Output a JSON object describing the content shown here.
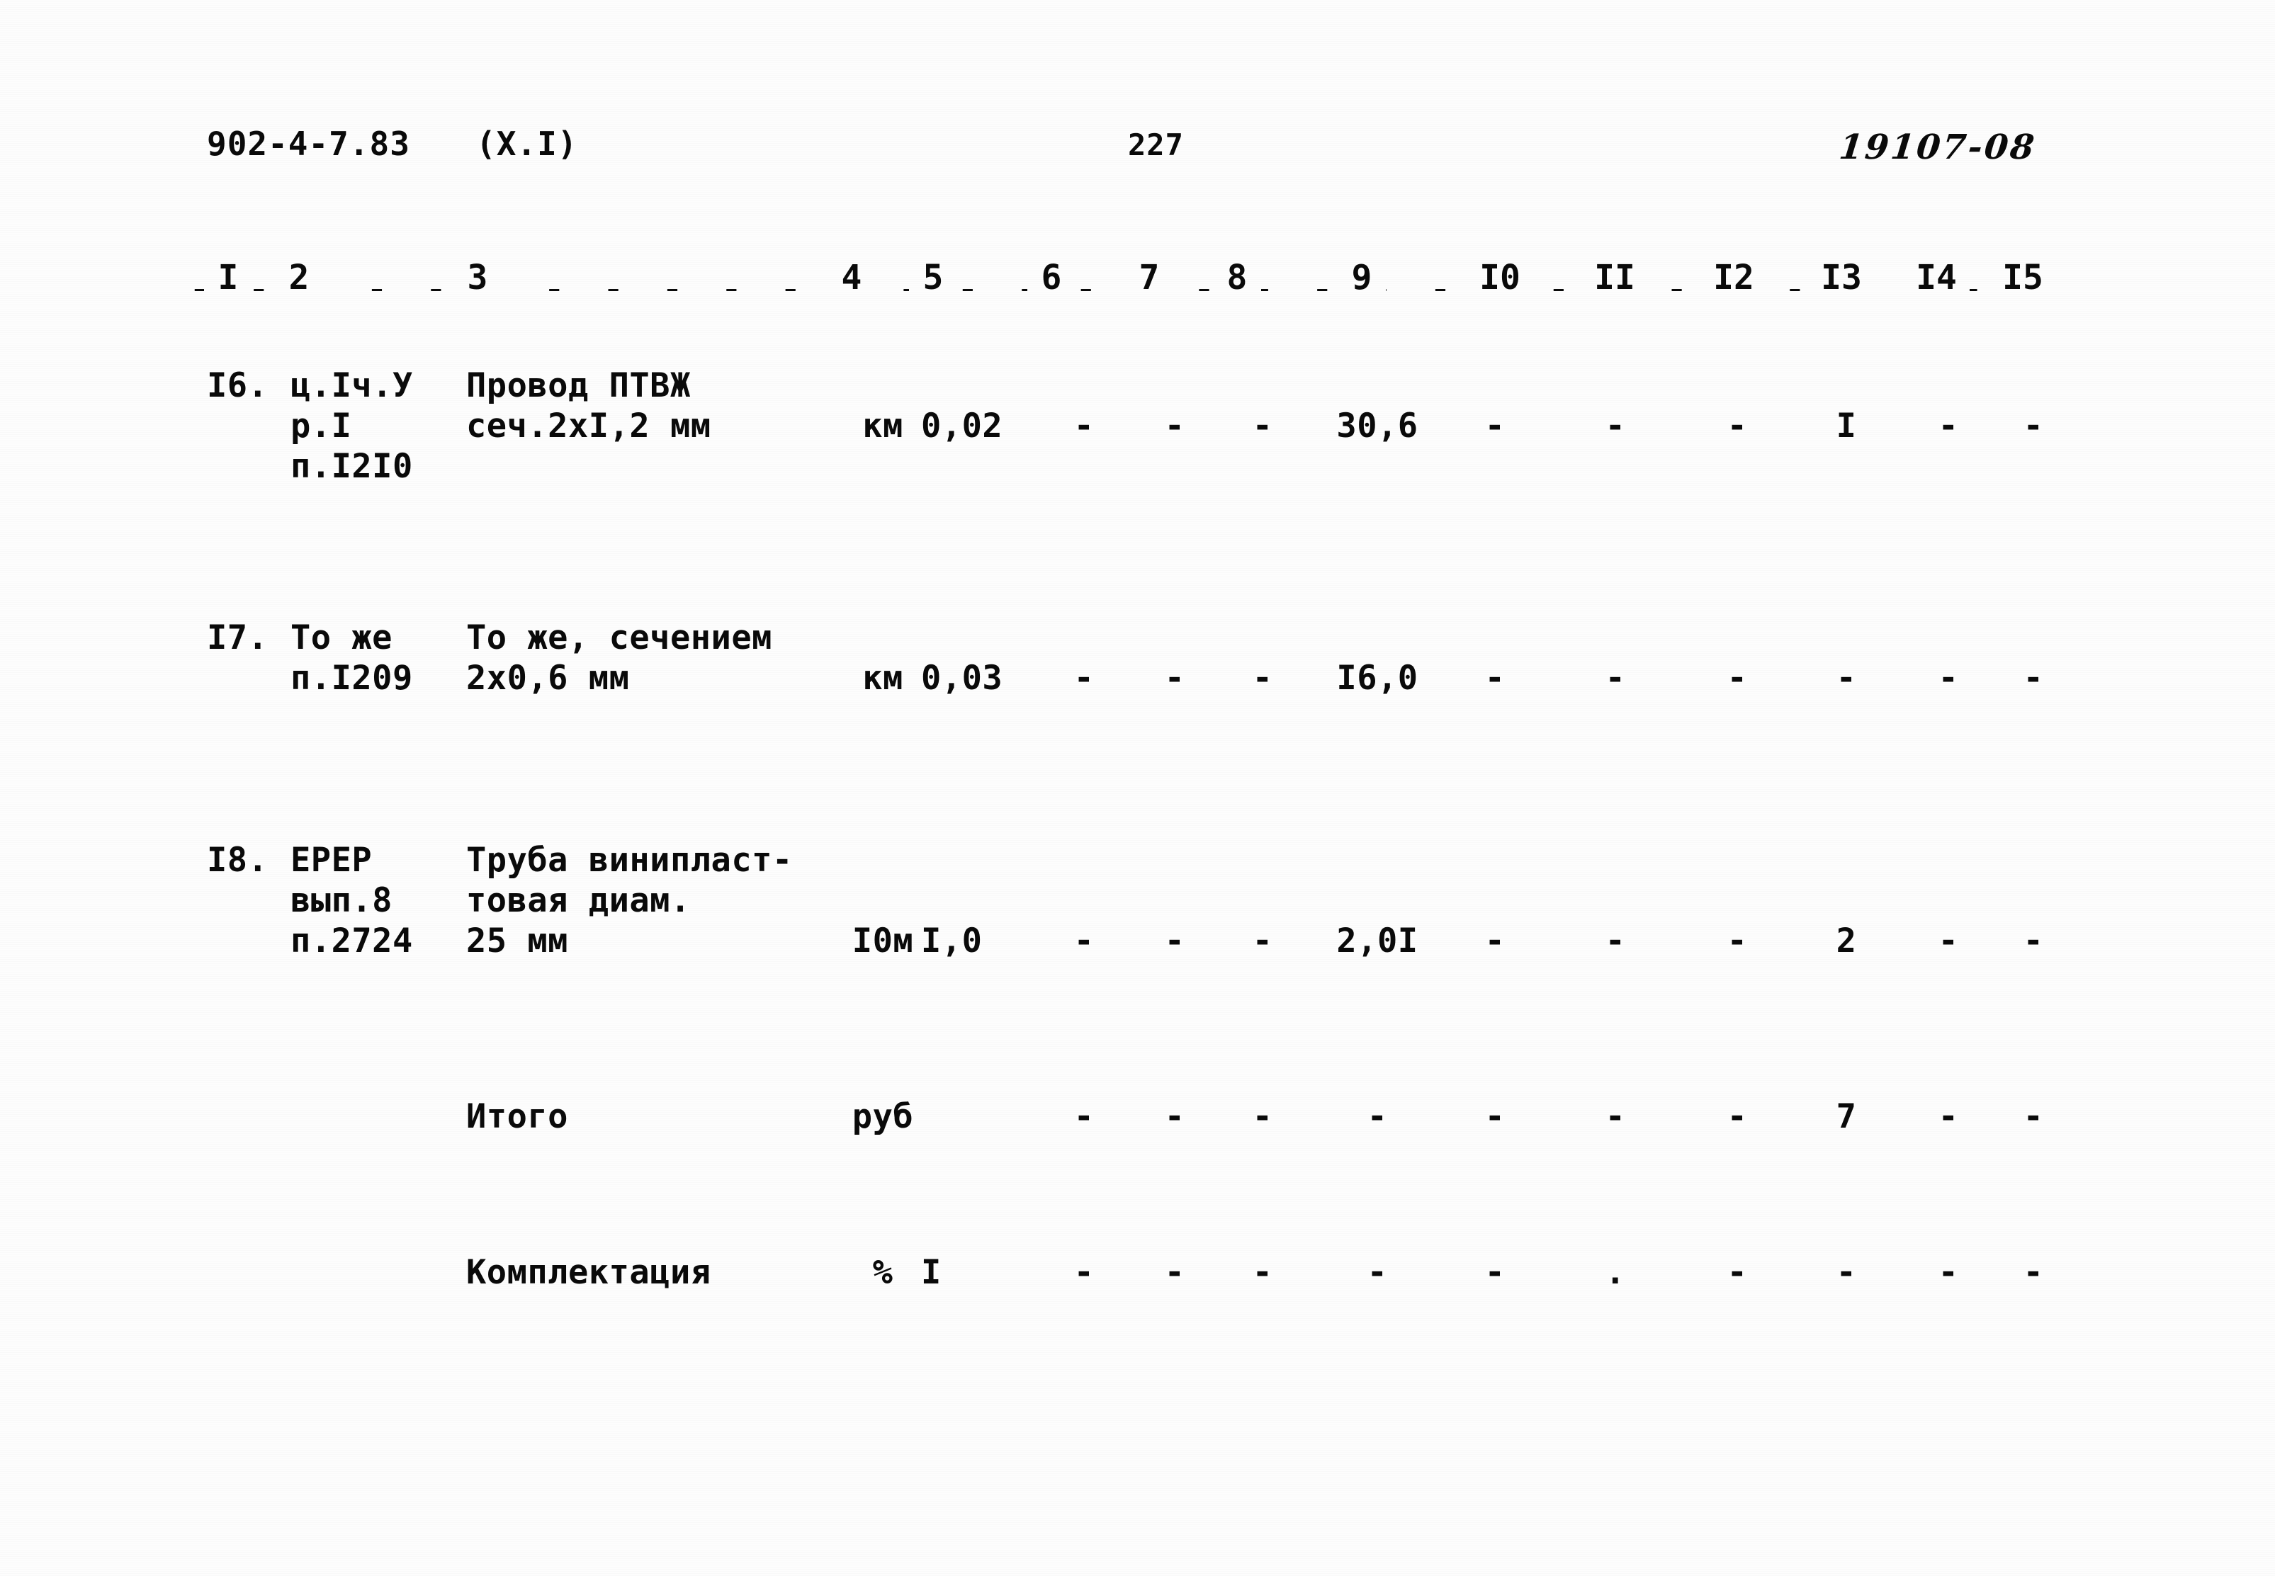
{
  "header": {
    "document_code": "902-4-7.83",
    "variant": "(X.I)",
    "page_number": "227",
    "archive_stamp": "19107-08"
  },
  "table": {
    "column_numbers": [
      "I",
      "2",
      "3",
      "4",
      "5",
      "6",
      "7",
      "8",
      "9",
      "I0",
      "II",
      "I2",
      "I3",
      "I4",
      "I5"
    ],
    "rows": [
      {
        "no": "I6.",
        "justification": "ц.Iч.У\nр.I\nп.I2I0",
        "name": "Провод ПТВЖ\nсеч.2хI,2 мм",
        "unit": "км",
        "c5": "0,02",
        "c6": "-",
        "c7": "-",
        "c8": "-",
        "c9": "30,6",
        "c10": "-",
        "c11": "-",
        "c12": "-",
        "c13": "I",
        "c14": "-",
        "c15": "-"
      },
      {
        "no": "I7.",
        "justification": "То же\nп.I209",
        "name": "То же, сечением\n2х0,6 мм",
        "unit": "км",
        "c5": "0,03",
        "c6": "-",
        "c7": "-",
        "c8": "-",
        "c9": "I6,0",
        "c10": "-",
        "c11": "-",
        "c12": "-",
        "c13": "-",
        "c14": "-",
        "c15": "-"
      },
      {
        "no": "I8.",
        "justification": "ЕРЕР\nвып.8\nп.2724",
        "name": "Труба винипласт-\nтовая диам.\n25 мм",
        "unit": "I0м",
        "c5": "I,0",
        "c6": "-",
        "c7": "-",
        "c8": "-",
        "c9": "2,0I",
        "c10": "-",
        "c11": "-",
        "c12": "-",
        "c13": "2",
        "c14": "-",
        "c15": "-"
      },
      {
        "no": "",
        "justification": "",
        "name": "Итого",
        "unit": "руб",
        "c5": "",
        "c6": "-",
        "c7": "-",
        "c8": "-",
        "c9": "-",
        "c10": "-",
        "c11": "-",
        "c12": "-",
        "c13": "7",
        "c14": "-",
        "c15": "-"
      },
      {
        "no": "",
        "justification": "",
        "name": "Комплектация",
        "unit": "%",
        "c5": "I",
        "c6": "-",
        "c7": "-",
        "c8": "-",
        "c9": "-",
        "c10": "-",
        "c11": ".",
        "c12": "-",
        "c13": "-",
        "c14": "-",
        "c15": "-"
      }
    ]
  },
  "rules": {
    "dash_glyph": "- - - - - - - - - - - - - - - - - - - - - - - - - - - - - - - - - - - - - - - - - - - - - - - - - - - - - - - - - - - - - - - - - - - - - - - - - - - - - - - - - - - - - - - - - - - - - - - - - - - - - - - - - - -"
  },
  "colors": {
    "ink": "#0a0a0a",
    "paper": "#fdfdfd"
  }
}
